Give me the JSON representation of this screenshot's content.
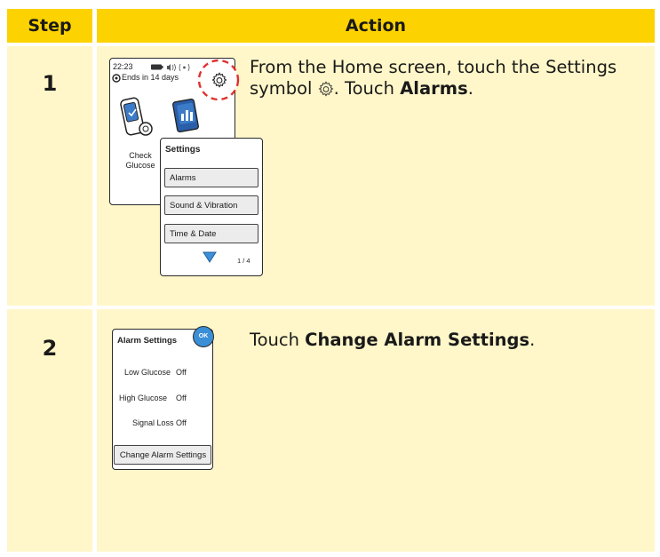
{
  "header": {
    "step": "Step",
    "action": "Action"
  },
  "rows": [
    {
      "step": "1",
      "text_before": "From the Home screen, touch the Settings symbol ",
      "text_after": ". Touch ",
      "text_bold": "Alarms",
      "text_end": ".",
      "home": {
        "time": "22:23",
        "status": "Ends in 14 days",
        "check_label_1": "Check",
        "check_label_2": "Glucose"
      },
      "settings": {
        "title": "Settings",
        "items": [
          "Alarms",
          "Sound & Vibration",
          "Time & Date"
        ],
        "page": "1 / 4"
      },
      "highlight_color": "#e03030"
    },
    {
      "step": "2",
      "text_before": "Touch ",
      "text_bold": "Change Alarm Settings",
      "text_end": ".",
      "alarm": {
        "title": "Alarm Settings",
        "ok": "OK",
        "rows": [
          {
            "label": "Low Glucose",
            "value": "Off"
          },
          {
            "label": "High Glucose",
            "value": "Off"
          },
          {
            "label": "Signal Loss",
            "value": "Off"
          }
        ],
        "button": "Change Alarm Settings"
      }
    }
  ],
  "colors": {
    "header": "#fcd200",
    "cell": "#fff7c9",
    "ok_badge": "#3b8fd6"
  }
}
